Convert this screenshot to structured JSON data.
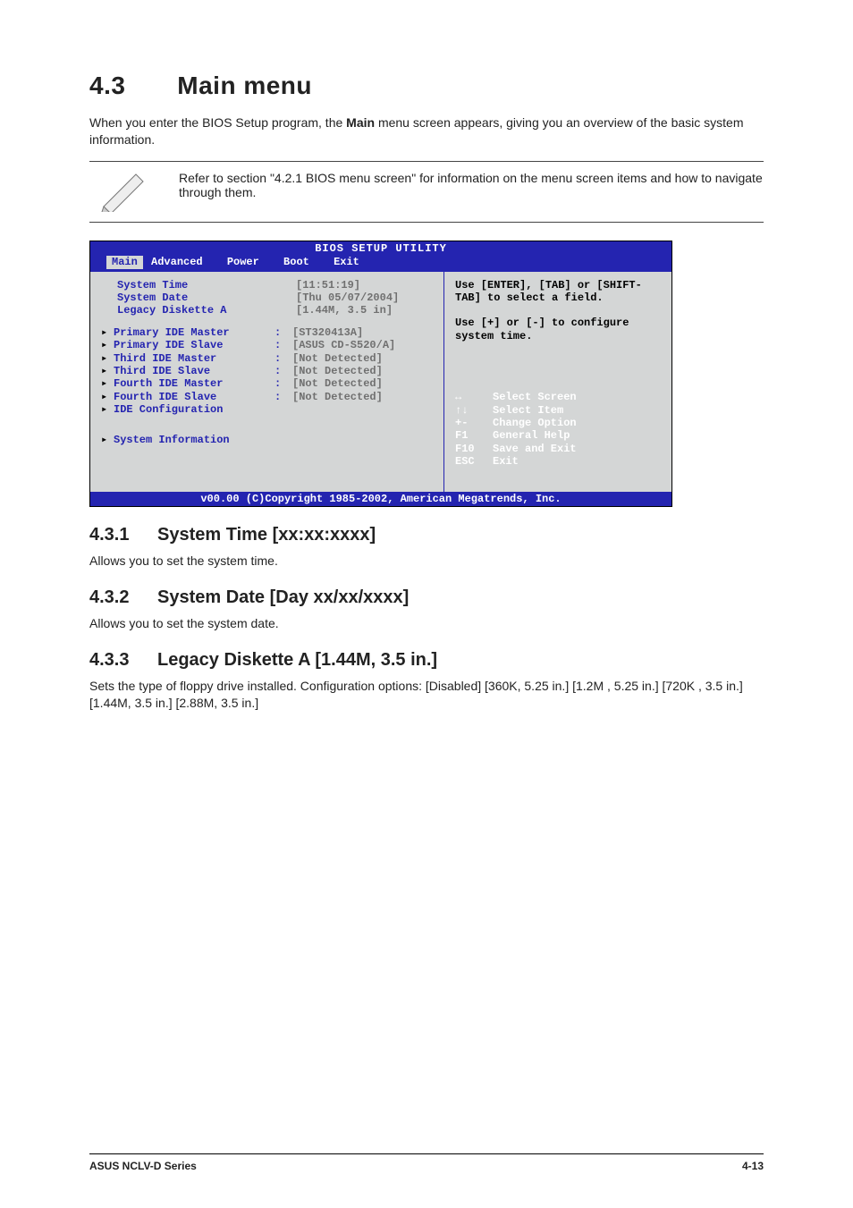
{
  "section": {
    "number": "4.3",
    "title": "Main menu"
  },
  "intro": {
    "line1": "When you enter the BIOS Setup program, the ",
    "bold": "Main",
    "line2": " menu screen appears, giving you an overview of the basic system information."
  },
  "note": "Refer to section \"4.2.1  BIOS menu screen\" for information on the menu screen items and how to navigate through them.",
  "bios": {
    "title": "BIOS SETUP UTILITY",
    "tabs": [
      "Main",
      "Advanced",
      "Power",
      "Boot",
      "Exit"
    ],
    "selected_tab": "Main",
    "fields": [
      {
        "label": "System Time",
        "value": "[11:51:19]"
      },
      {
        "label": "System Date",
        "value": "[Thu 05/07/2004]"
      },
      {
        "label": "Legacy Diskette A",
        "value": "[1.44M, 3.5 in]"
      }
    ],
    "ide": [
      {
        "label": "Primary IDE Master",
        "value": "[ST320413A]"
      },
      {
        "label": "Primary IDE Slave",
        "value": "[ASUS CD-S520/A]"
      },
      {
        "label": "Third IDE Master",
        "value": "[Not Detected]"
      },
      {
        "label": "Third IDE Slave",
        "value": "[Not Detected]"
      },
      {
        "label": "Fourth IDE Master",
        "value": "[Not Detected]"
      },
      {
        "label": "Fourth IDE Slave",
        "value": "[Not Detected]"
      },
      {
        "label": "IDE Configuration",
        "value": ""
      }
    ],
    "sysinfo": "System Information",
    "help1": "Use [ENTER], [TAB] or [SHIFT-TAB] to select a field.",
    "help2": "Use [+] or [-] to configure system time.",
    "keys": [
      {
        "k": "↔",
        "d": "Select Screen"
      },
      {
        "k": "↑↓",
        "d": "Select Item"
      },
      {
        "k": "+-",
        "d": "Change Option"
      },
      {
        "k": "F1",
        "d": "General Help"
      },
      {
        "k": "F10",
        "d": "Save and Exit"
      },
      {
        "k": "ESC",
        "d": "Exit"
      }
    ],
    "copyright": "v00.00 (C)Copyright 1985-2002, American Megatrends, Inc."
  },
  "sub": [
    {
      "num": "4.3.1",
      "title": "System Time [xx:xx:xxxx]",
      "body": "Allows you to set the system time."
    },
    {
      "num": "4.3.2",
      "title": "System Date [Day xx/xx/xxxx]",
      "body": "Allows you to set the system date."
    },
    {
      "num": "4.3.3",
      "title": "Legacy Diskette A [1.44M, 3.5 in.]",
      "body": "Sets the type of floppy drive installed. Configuration options: [Disabled] [360K, 5.25 in.] [1.2M , 5.25 in.] [720K , 3.5 in.] [1.44M, 3.5 in.] [2.88M, 3.5 in.]"
    }
  ],
  "footer": {
    "left": "ASUS NCLV-D Series",
    "right": "4-13"
  }
}
